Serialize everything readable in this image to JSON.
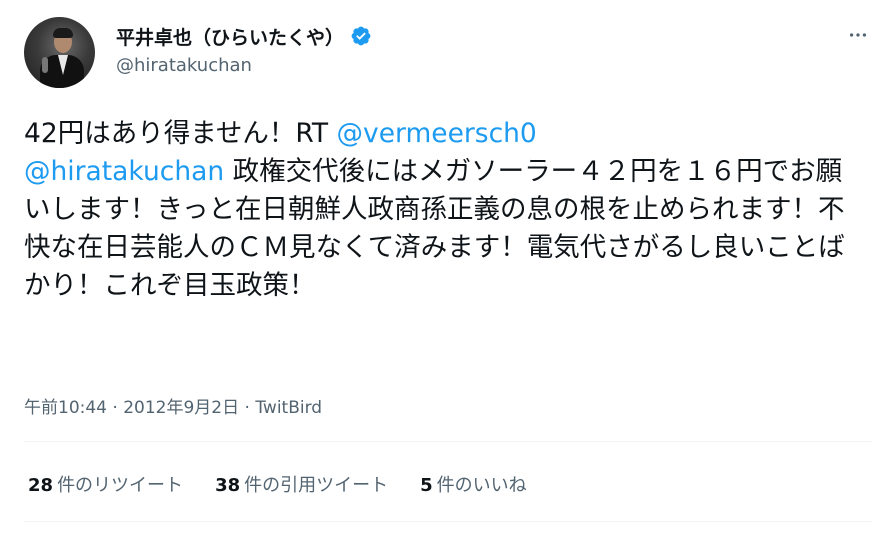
{
  "author": {
    "display_name": "平井卓也（ひらいたくや）",
    "handle": "@hiratakuchan",
    "verified": true
  },
  "tweet": {
    "segments": [
      {
        "text": "42円はあり得ません！RT ",
        "type": "text"
      },
      {
        "text": "@vermeersch0",
        "type": "mention"
      },
      {
        "text": "\n",
        "type": "text"
      },
      {
        "text": "@hiratakuchan",
        "type": "mention"
      },
      {
        "text": " 政権交代後にはメガソーラー４２円を１６円でお願いします！きっと在日朝鮮人政商孫正義の息の根を止められます！不快な在日芸能人のＣＭ見なくて済みます！電気代さがるし良いことばかり！これぞ目玉政策！",
        "type": "text"
      }
    ]
  },
  "meta": {
    "time": "午前10:44",
    "date": "2012年9月2日",
    "separator": " · ",
    "source": "TwitBird"
  },
  "stats": {
    "retweets": {
      "count": "28",
      "label": "件のリツイート"
    },
    "quotes": {
      "count": "38",
      "label": "件の引用ツイート"
    },
    "likes": {
      "count": "5",
      "label": "件のいいね"
    }
  },
  "icons": {
    "verified": "verified-badge-icon",
    "more": "more-options-icon"
  },
  "colors": {
    "mention": "#1d9bf0",
    "secondary_text": "#536471",
    "primary_text": "#0f1419",
    "verified_badge": "#1d9bf0"
  }
}
